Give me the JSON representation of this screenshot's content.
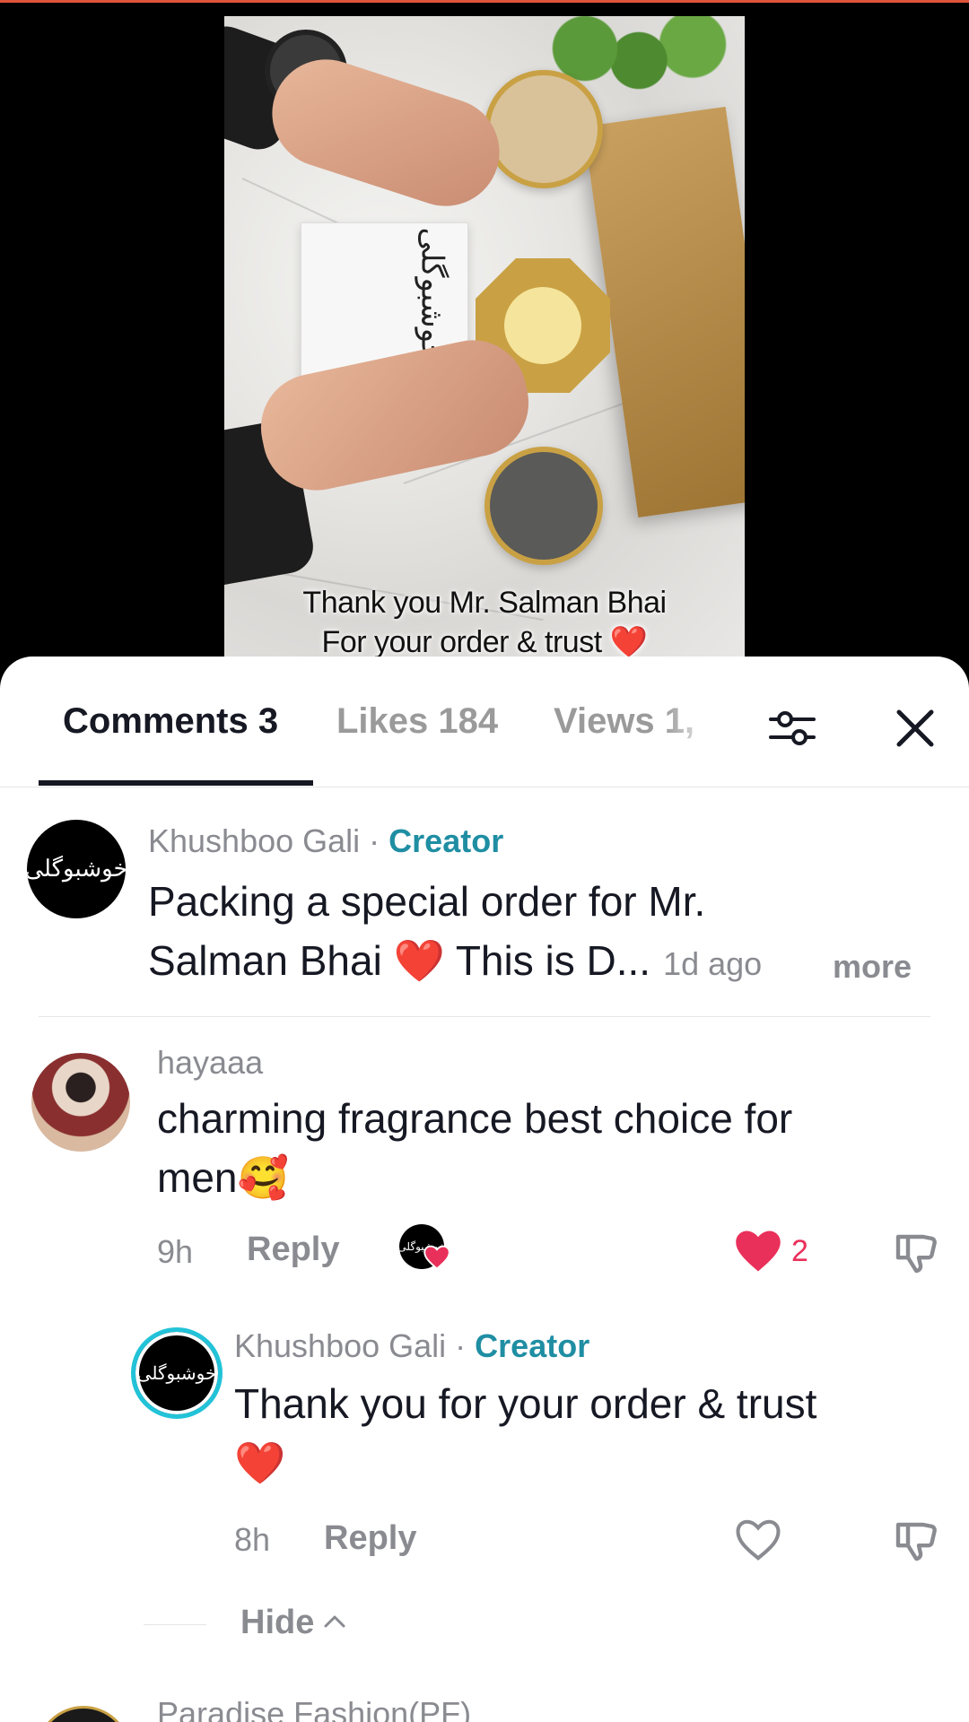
{
  "video": {
    "caption_line1": "Thank you Mr. Salman Bhai",
    "caption_line2": "For your order & trust ❤️",
    "box_logo_text": "خوشبوگلی"
  },
  "tabs": [
    {
      "label": "Comments 3",
      "active": true
    },
    {
      "label": "Likes 184",
      "active": false
    },
    {
      "label": "Views 1,",
      "active": false
    }
  ],
  "icons": {
    "filter": "filter-sliders-icon",
    "close": "close-icon",
    "like": "heart-icon",
    "dislike": "thumbs-down-icon",
    "chevron": "chevron-up-icon"
  },
  "colors": {
    "accent_creator": "#1f8ea3",
    "like_red": "#e9305a",
    "muted": "#8a8b91",
    "text": "#161823"
  },
  "comments": [
    {
      "username": "Khushboo Gali",
      "badge": "Creator",
      "avatar_text": "خوشبوگلی",
      "text_line1": "Packing a special order for Mr.",
      "text_line2": "Salman Bhai ❤️ This is D...",
      "time": "1d ago",
      "more": "more"
    },
    {
      "username": "hayaaa",
      "text_line1": "charming fragrance best choice for",
      "text_line2": "men🥰",
      "time": "9h",
      "reply": "Reply",
      "likes": "2"
    }
  ],
  "reply": {
    "username": "Khushboo Gali",
    "badge": "Creator",
    "avatar_text": "خوشبوگلی",
    "text_line1": "Thank you for your order & trust",
    "text_line2": "❤️",
    "time": "8h",
    "reply": "Reply"
  },
  "hide": {
    "label": "Hide"
  },
  "next_comment": {
    "username": "Paradise Fashion(PF)"
  }
}
